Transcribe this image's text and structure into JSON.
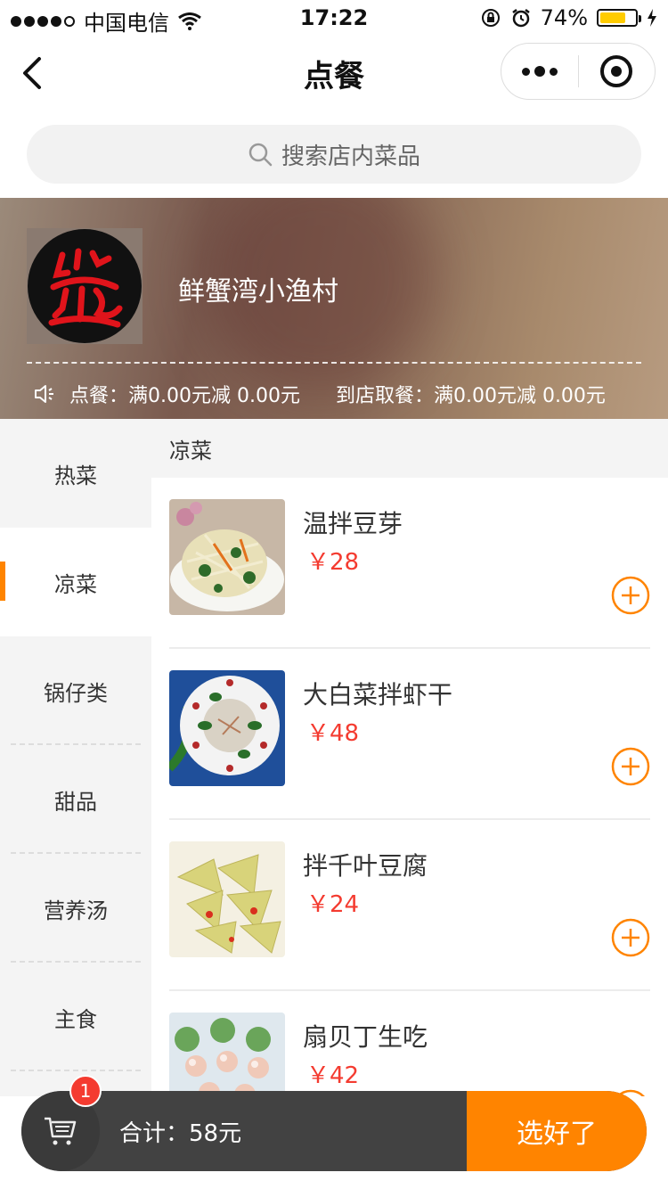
{
  "status_bar": {
    "carrier": "中国电信",
    "time": "17:22",
    "battery": "74%",
    "battery_level": 0.74
  },
  "nav": {
    "title": "点餐"
  },
  "search": {
    "placeholder": "搜索店内菜品"
  },
  "shop": {
    "name": "鲜蟹湾小渔村",
    "promo_dine": "点餐：满0.00元减 0.00元",
    "promo_pickup": "到店取餐：满0.00元减 0.00元"
  },
  "categories": [
    {
      "label": "热菜",
      "active": false
    },
    {
      "label": "凉菜",
      "active": true
    },
    {
      "label": "锅仔类",
      "active": false
    },
    {
      "label": "甜品",
      "active": false
    },
    {
      "label": "营养汤",
      "active": false
    },
    {
      "label": "主食",
      "active": false
    }
  ],
  "section_title": "凉菜",
  "items": [
    {
      "name": "温拌豆芽",
      "price": "￥28"
    },
    {
      "name": "大白菜拌虾干",
      "price": "￥48"
    },
    {
      "name": "拌千叶豆腐",
      "price": "￥24"
    },
    {
      "name": "扇贝丁生吃",
      "price": "￥42"
    }
  ],
  "cart": {
    "badge": "1",
    "total": "合计：58元",
    "checkout": "选好了"
  },
  "colors": {
    "accent": "#ff8400",
    "price": "#f43b30",
    "cart_bg": "#424242"
  }
}
